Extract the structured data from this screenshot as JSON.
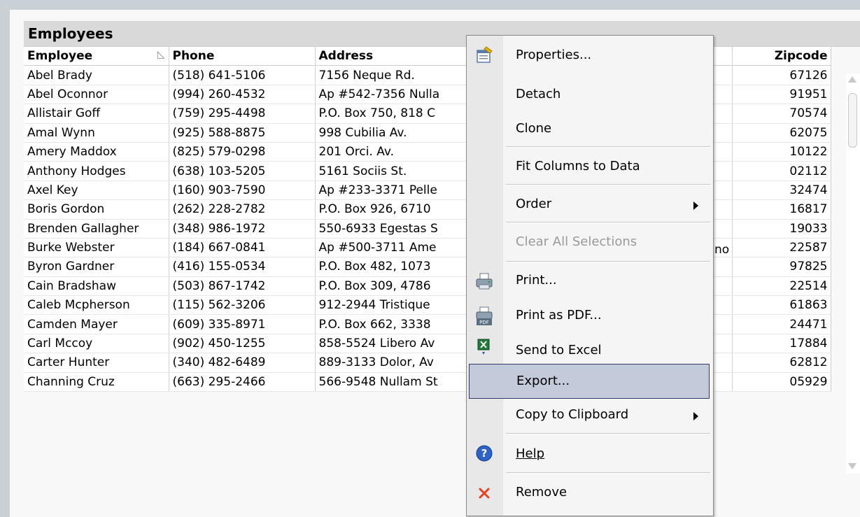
{
  "table": {
    "title": "Employees",
    "columns": {
      "employee": "Employee",
      "phone": "Phone",
      "address": "Address",
      "zipcode": "Zipcode"
    },
    "extra_visible_text": "no",
    "rows": [
      {
        "employee": "Abel Brady",
        "phone": "(518) 641-5106",
        "address": "7156 Neque Rd.",
        "zipcode": "67126"
      },
      {
        "employee": "Abel Oconnor",
        "phone": "(994) 260-4532",
        "address": "Ap #542-7356 Nulla",
        "zipcode": "91951"
      },
      {
        "employee": "Allistair Goff",
        "phone": "(759) 295-4498",
        "address": "P.O. Box 750, 818 C",
        "zipcode": "70574"
      },
      {
        "employee": "Amal Wynn",
        "phone": "(925) 588-8875",
        "address": "998 Cubilia Av.",
        "zipcode": "62075"
      },
      {
        "employee": "Amery Maddox",
        "phone": "(825) 579-0298",
        "address": "201 Orci. Av.",
        "zipcode": "10122"
      },
      {
        "employee": "Anthony Hodges",
        "phone": "(638) 103-5205",
        "address": "5161 Sociis St.",
        "zipcode": "02112"
      },
      {
        "employee": "Axel Key",
        "phone": "(160) 903-7590",
        "address": "Ap #233-3371 Pelle",
        "zipcode": "32474"
      },
      {
        "employee": "Boris Gordon",
        "phone": "(262) 228-2782",
        "address": "P.O. Box 926, 6710",
        "zipcode": "16817"
      },
      {
        "employee": "Brenden Gallagher",
        "phone": "(348) 986-1972",
        "address": "550-6933 Egestas S",
        "zipcode": "19033"
      },
      {
        "employee": "Burke Webster",
        "phone": "(184) 667-0841",
        "address": "Ap #500-3711 Ame",
        "zipcode": "22587"
      },
      {
        "employee": "Byron Gardner",
        "phone": "(416) 155-0534",
        "address": "P.O. Box 482, 1073",
        "zipcode": "97825"
      },
      {
        "employee": "Cain Bradshaw",
        "phone": "(503) 867-1742",
        "address": "P.O. Box 309, 4786",
        "zipcode": "22514"
      },
      {
        "employee": "Caleb Mcpherson",
        "phone": "(115) 562-3206",
        "address": "912-2944 Tristique",
        "zipcode": "61863"
      },
      {
        "employee": "Camden Mayer",
        "phone": "(609) 335-8971",
        "address": "P.O. Box 662, 3338",
        "zipcode": "24471"
      },
      {
        "employee": "Carl Mccoy",
        "phone": "(902) 450-1255",
        "address": "858-5524 Libero Av",
        "zipcode": "17884"
      },
      {
        "employee": "Carter Hunter",
        "phone": "(340) 482-6489",
        "address": "889-3133 Dolor, Av",
        "zipcode": "62812"
      },
      {
        "employee": "Channing Cruz",
        "phone": "(663) 295-2466",
        "address": "566-9548 Nullam St",
        "zipcode": "05929"
      }
    ]
  },
  "menu": {
    "properties": "Properties...",
    "detach": "Detach",
    "clone": "Clone",
    "fit_columns": "Fit Columns to Data",
    "order": "Order",
    "clear_selections": "Clear All Selections",
    "print": "Print...",
    "print_pdf": "Print as PDF...",
    "send_excel": "Send to Excel",
    "export": "Export...",
    "copy_clipboard": "Copy to Clipboard",
    "help": "Help",
    "remove": "Remove"
  },
  "colors": {
    "highlight": "#c3cad9",
    "highlight_border": "#35396a",
    "caption": "#d9d9d9"
  }
}
